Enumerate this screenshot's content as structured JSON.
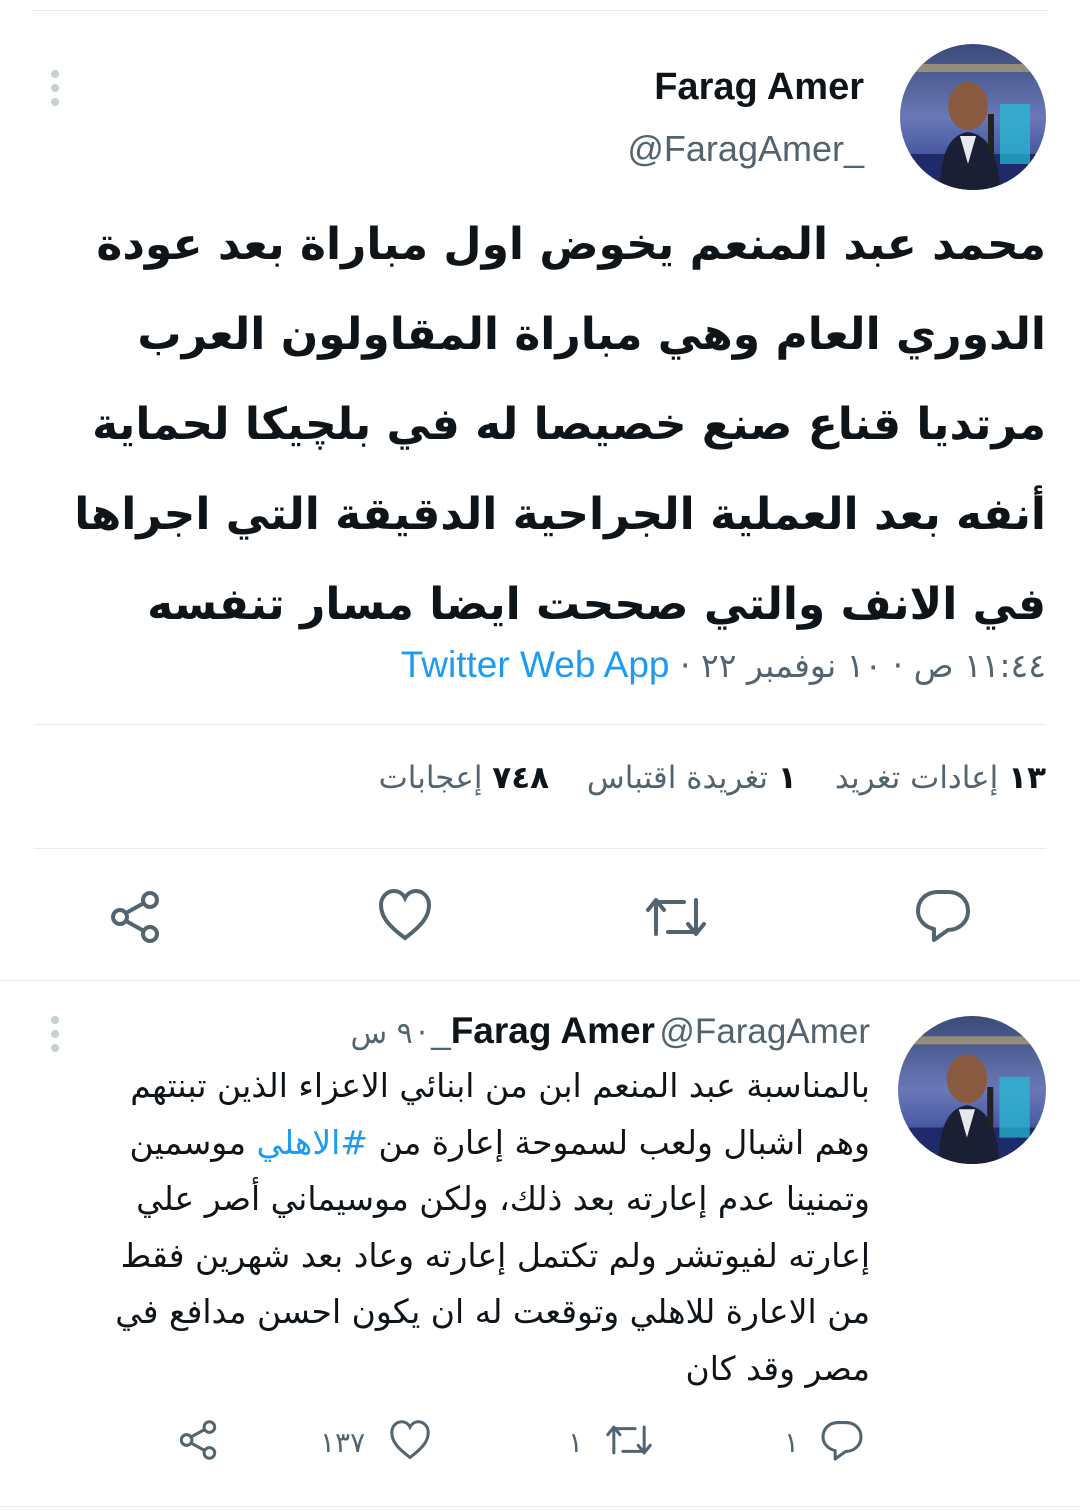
{
  "main_tweet": {
    "author_name": "Farag Amer",
    "author_handle": "@FaragAmer_",
    "text_lines": [
      "محمد عبد المنعم يخوض اول مباراة بعد عودة",
      "الدوري العام وهي مباراة المقاولون العرب",
      "مرتديا قناع  صنع خصيصا له في بلچيكا لحماية",
      "أنفه بعد العملية الجراحية الدقيقة التي اجراها",
      "في الانف والتي  صححت ايضا مسار تنفسه"
    ],
    "timestamp": "١١:٤٤ ص · ١٠ نوفمبر ٢٢ ·",
    "source_app": "Twitter Web App",
    "stats": {
      "retweets_count": "١٣",
      "retweets_label": "إعادات تغريد",
      "quotes_count": "١",
      "quotes_label": "تغريدة اقتباس",
      "likes_count": "٧٤٨",
      "likes_label": "إعجابات"
    }
  },
  "reply_tweet": {
    "author_name": "Farag Amer",
    "author_handle": "@FaragAmer_",
    "separator": "·",
    "time": "٩ س",
    "text_lines": [
      "بالمناسبة عبد المنعم ابن من ابنائي الاعزاء الذين تبنتهم",
      "وهم اشبال ولعب لسموحة إعارة من ",
      "وتمنينا عدم إعارته بعد ذلك، ولكن موسيماني أصر علي",
      "إعارته لفيوتشر ولم تكتمل إعارته وعاد بعد شهرين فقط",
      "من  الاعارة للاهلي وتوقعت له ان يكون احسن مدافع في",
      "مصر وقد كان"
    ],
    "hashtag": "#الاهلي",
    "line2_after_hashtag": " موسمين",
    "counts": {
      "replies": "١",
      "retweets": "١",
      "likes": "١٣٧"
    }
  },
  "icons": {
    "reply": "comment-bubble-icon",
    "retweet": "retweet-arrows-icon",
    "like": "heart-icon",
    "share": "share-nodes-icon",
    "more": "vertical-dots-icon"
  },
  "colors": {
    "text": "#0f1419",
    "secondary": "#536471",
    "link": "#1d9bf0",
    "divider": "#e6ecf0"
  }
}
